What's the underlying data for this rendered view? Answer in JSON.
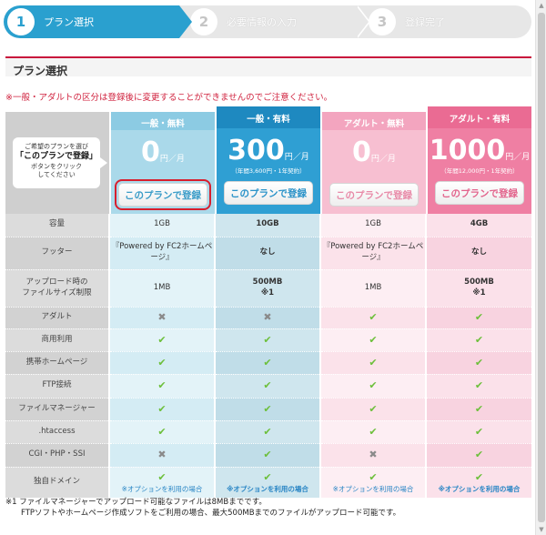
{
  "stepper": {
    "steps": [
      {
        "num": "1",
        "label": "プラン選択"
      },
      {
        "num": "2",
        "label": "必要情報の入力"
      },
      {
        "num": "3",
        "label": "登録完了"
      }
    ]
  },
  "section_title": "プラン選択",
  "notice": "※一般・アダルトの区分は登録後に変更することができませんのでご注意ください。",
  "intro": {
    "line1": "ご希望のプランを選び",
    "emph": "「このプランで登録」",
    "line2": "ボタンをクリック",
    "line3": "してください"
  },
  "plans": [
    {
      "name": "一般・無料",
      "price": "0",
      "unit": "円／月",
      "sub": "",
      "button": "このプランで登録"
    },
    {
      "name": "一般・有料",
      "price": "300",
      "unit": "円／月",
      "sub": "（年間3,600円・1年契約）",
      "button": "このプランで登録"
    },
    {
      "name": "アダルト・無料",
      "price": "0",
      "unit": "円／月",
      "sub": "",
      "button": "このプランで登録"
    },
    {
      "name": "アダルト・有料",
      "price": "1000",
      "unit": "円／月",
      "sub": "（年間12,000円・1年契約）",
      "button": "このプランで登録"
    }
  ],
  "features": [
    {
      "label": "容量",
      "values": [
        "1GB",
        "10GB",
        "1GB",
        "4GB"
      ]
    },
    {
      "label": "フッター",
      "values": [
        "『Powered by FC2ホームページ』",
        "なし",
        "『Powered by FC2ホームページ』",
        "なし"
      ]
    },
    {
      "label": "アップロード時の\nファイルサイズ制限",
      "values": [
        "1MB",
        "500MB\n※1",
        "1MB",
        "500MB\n※1"
      ]
    },
    {
      "label": "アダルト",
      "values": [
        "x",
        "x",
        "check",
        "check"
      ]
    },
    {
      "label": "商用利用",
      "values": [
        "check",
        "check",
        "check",
        "check"
      ]
    },
    {
      "label": "携帯ホームページ",
      "values": [
        "check",
        "check",
        "check",
        "check"
      ]
    },
    {
      "label": "FTP接続",
      "values": [
        "check",
        "check",
        "check",
        "check"
      ]
    },
    {
      "label": "ファイルマネージャー",
      "values": [
        "check",
        "check",
        "check",
        "check"
      ]
    },
    {
      "label": ".htaccess",
      "values": [
        "check",
        "check",
        "check",
        "check"
      ]
    },
    {
      "label": "CGI・PHP・SSI",
      "values": [
        "x",
        "check",
        "x",
        "check"
      ]
    },
    {
      "label": "独自ドメイン",
      "values": [
        "check",
        "check",
        "check",
        "check"
      ]
    }
  ],
  "option_note": "※オプションを利用の場合",
  "footnote": {
    "line1": "※1 ファイルマネージャーでアップロード可能なファイルは8MBまでです。",
    "line2": "FTPソフトやホームページ作成ソフトをご利用の場合、最大500MBまでのファイルがアップロード可能です。"
  },
  "glyphs": {
    "check": "✔",
    "x": "✖"
  },
  "colors": {
    "accent_blue": "#2aa0cf",
    "accent_pink": "#ef7fa3",
    "highlight_red": "#d81e2d",
    "check_green": "#6cbf3a"
  }
}
